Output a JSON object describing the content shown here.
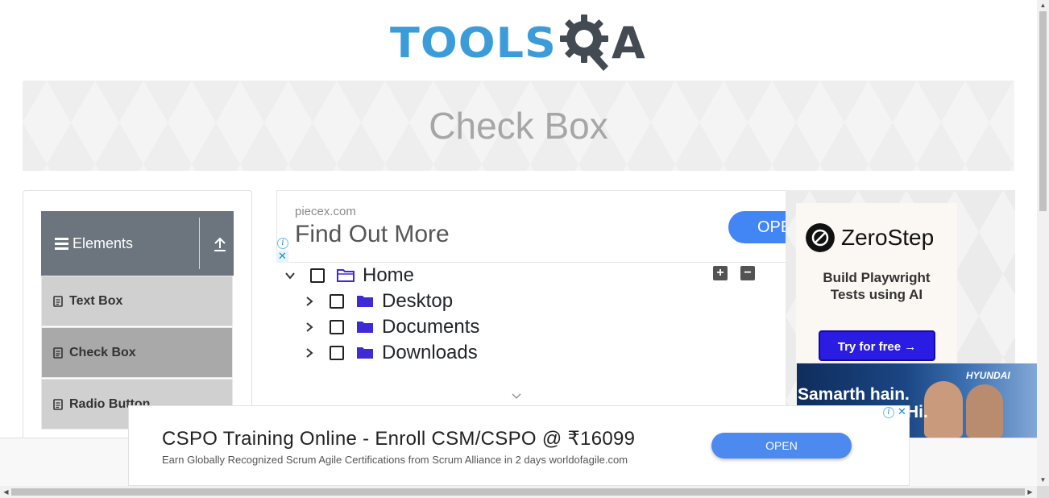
{
  "header": {
    "logo_text_left": "TOOLS",
    "logo_text_right": "A"
  },
  "banner": {
    "title": "Check Box"
  },
  "sidebar": {
    "group_title": "Elements",
    "items": [
      {
        "label": "Text Box"
      },
      {
        "label": "Check Box"
      },
      {
        "label": "Radio Button"
      }
    ]
  },
  "top_ad": {
    "domain": "piecex.com",
    "headline": "Find Out More",
    "button": "OPEN"
  },
  "tree": {
    "nodes": [
      {
        "label": "Home",
        "expanded": true,
        "checked": false
      },
      {
        "label": "Desktop",
        "expanded": false,
        "checked": false
      },
      {
        "label": "Documents",
        "expanded": false,
        "checked": false
      },
      {
        "label": "Downloads",
        "expanded": false,
        "checked": false
      }
    ],
    "expand_all": "+",
    "collapse_all": "−"
  },
  "zerostep_ad": {
    "brand": "ZeroStep",
    "tagline_1": "Build Playwright",
    "tagline_2": "Tests using AI",
    "button": "Try for free →"
  },
  "hyundai_ad": {
    "brand": "HYUNDAI",
    "text_1": "Samarth hain.",
    "text_2": "Hi."
  },
  "bottom_ad": {
    "headline": "CSPO Training Online - Enroll CSM/CSPO @ ₹16099",
    "subtext": "Earn Globally Recognized Scrum Agile Certifications from Scrum Alliance in 2 days worldofagile.com",
    "button": "OPEN"
  },
  "colors": {
    "logo_blue": "#3b9cd9",
    "logo_dark": "#434a52",
    "sidebar_header": "#6c757d",
    "sidebar_item": "#d0d0d0",
    "sidebar_item_active": "#a9a9a9",
    "folder": "#3e2bd6",
    "ad_button": "#4285f4",
    "zerostep_button": "#2b1ce4"
  }
}
